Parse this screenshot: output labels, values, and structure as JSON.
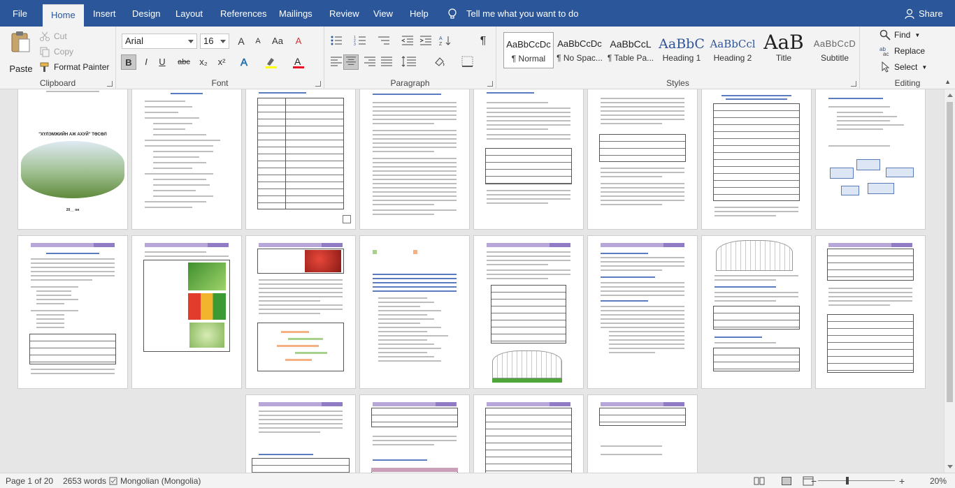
{
  "tabs": [
    {
      "label": "File",
      "active": false
    },
    {
      "label": "Home",
      "active": true
    },
    {
      "label": "Insert",
      "active": false
    },
    {
      "label": "Design",
      "active": false
    },
    {
      "label": "Layout",
      "active": false
    },
    {
      "label": "References",
      "active": false
    },
    {
      "label": "Mailings",
      "active": false
    },
    {
      "label": "Review",
      "active": false
    },
    {
      "label": "View",
      "active": false
    },
    {
      "label": "Help",
      "active": false
    }
  ],
  "tell_me": "Tell me what you want to do",
  "share": "Share",
  "clipboard": {
    "label": "Clipboard",
    "paste": "Paste",
    "cut": "Cut",
    "copy": "Copy",
    "format_painter": "Format Painter"
  },
  "font": {
    "label": "Font",
    "family": "Arial",
    "size": "16",
    "bold": "B",
    "italic": "I",
    "underline": "U",
    "strike": "abc",
    "subscript": "x₂",
    "superscript": "x²",
    "grow": "A",
    "shrink": "A",
    "case": "Aa",
    "clear": "A",
    "highlight_color": "#ffff00",
    "font_color": "#e81123"
  },
  "paragraph": {
    "label": "Paragraph",
    "pilcrow": "¶"
  },
  "styles": {
    "label": "Styles",
    "items": [
      {
        "sample": "AaBbCcDc",
        "name": "¶ Normal",
        "selected": true
      },
      {
        "sample": "AaBbCcDc",
        "name": "¶ No Spac...",
        "selected": false
      },
      {
        "sample": "AaBbCcL",
        "name": "¶ Table Pa...",
        "selected": false
      },
      {
        "sample": "AaBbC",
        "name": "Heading 1",
        "selected": false
      },
      {
        "sample": "AaBbCcl",
        "name": "Heading 2",
        "selected": false
      },
      {
        "sample": "AaB",
        "name": "Title",
        "selected": false
      },
      {
        "sample": "AaBbCcD",
        "name": "Subtitle",
        "selected": false
      }
    ]
  },
  "editing": {
    "label": "Editing",
    "find": "Find",
    "replace": "Replace",
    "select": "Select"
  },
  "document": {
    "cover_title": "\"ХҮЛЭМЖИЙН АЖ АХУЙ\" ТӨСӨЛ",
    "cover_year": "20__ он"
  },
  "status": {
    "page": "Page 1 of 20",
    "words": "2653 words",
    "language": "Mongolian (Mongolia)",
    "zoom": "20%"
  },
  "colors": {
    "accent": "#2b579a",
    "header_band": "#b7a7d9"
  }
}
